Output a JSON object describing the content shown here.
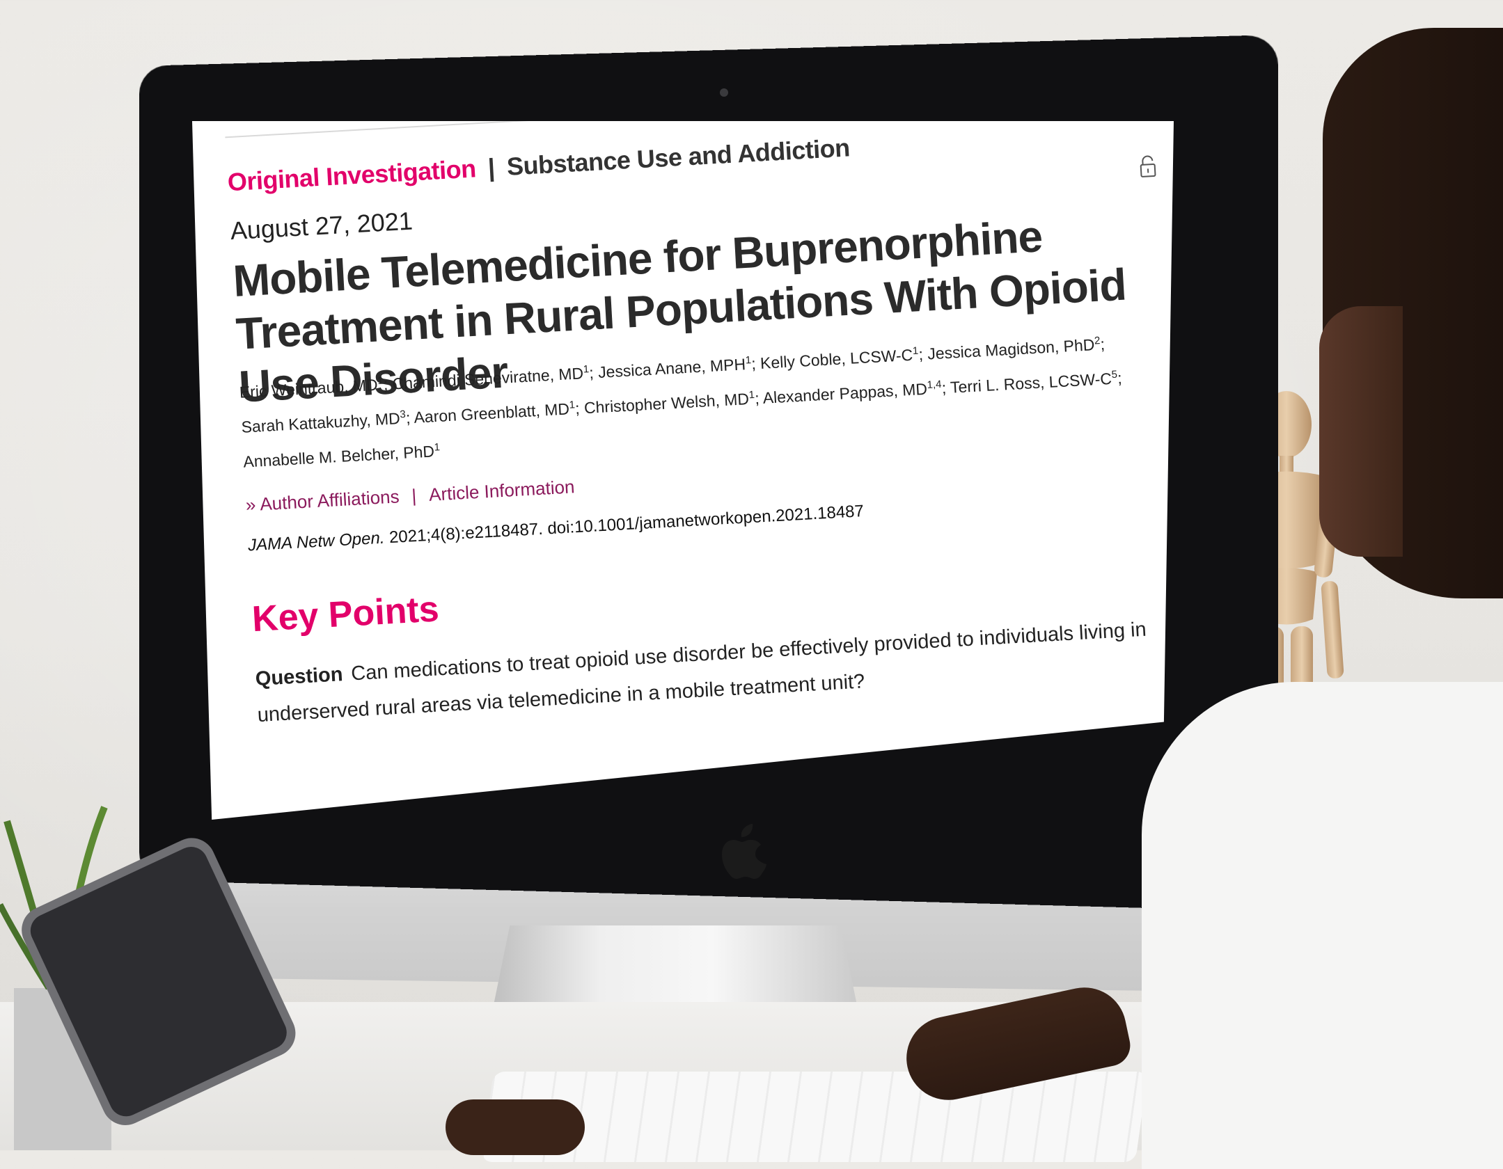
{
  "screen": {
    "article_type": "Original Investigation",
    "separator": "|",
    "section": "Substance Use and Addiction",
    "date": "August 27, 2021",
    "title": "Mobile Telemedicine for Buprenorphine Treatment in Rural Populations With Opioid Use Disorder",
    "authors": [
      {
        "name": "Eric Weintraub, MD",
        "aff": "1"
      },
      {
        "name": "Chamindi Seneviratne, MD",
        "aff": "1"
      },
      {
        "name": "Jessica Anane, MPH",
        "aff": "1"
      },
      {
        "name": "Kelly Coble, LCSW-C",
        "aff": "1"
      },
      {
        "name": "Jessica Magidson, PhD",
        "aff": "2"
      },
      {
        "name": "Sarah Kattakuzhy, MD",
        "aff": "3"
      },
      {
        "name": "Aaron Greenblatt, MD",
        "aff": "1"
      },
      {
        "name": "Christopher Welsh, MD",
        "aff": "1"
      },
      {
        "name": "Alexander Pappas, MD",
        "aff": "1,4"
      },
      {
        "name": "Terri L. Ross, LCSW-C",
        "aff": "5"
      },
      {
        "name": "Annabelle M. Belcher, PhD",
        "aff": "1"
      }
    ],
    "links": {
      "chevron": "»",
      "author_affiliations": "Author Affiliations",
      "divider": "|",
      "article_information": "Article Information"
    },
    "citation": {
      "journal": "JAMA Netw Open.",
      "details": "2021;4(8):e2118487. doi:10.1001/jamanetworkopen.2021.18487"
    },
    "key_points_heading": "Key Points",
    "question_label": "Question",
    "question_text": "Can medications to treat opioid use disorder be effectively provided to individuals living in underserved rural areas via telemedicine in a mobile treatment unit?",
    "icons": {
      "lock": "unlocked-lock-icon"
    },
    "colors": {
      "accent": "#e2006a",
      "link": "#8b1a5c",
      "text": "#2b2b2b"
    }
  }
}
